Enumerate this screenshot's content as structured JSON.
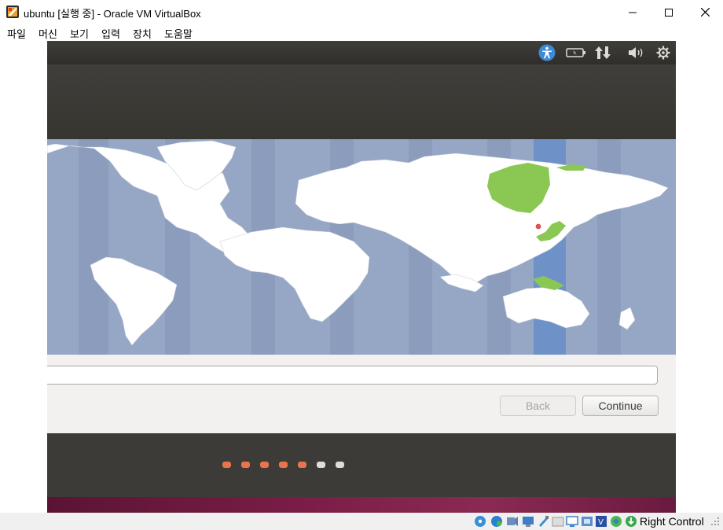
{
  "window": {
    "title": "ubuntu [실행 중] - Oracle VM VirtualBox",
    "minimize": "minimize",
    "maximize": "maximize",
    "close": "close"
  },
  "menu": [
    {
      "label": "파일"
    },
    {
      "label": "머신"
    },
    {
      "label": "보기"
    },
    {
      "label": "입력"
    },
    {
      "label": "장치"
    },
    {
      "label": "도움말"
    }
  ],
  "guest_panel": {
    "indicators": [
      "accessibility-icon",
      "battery-icon",
      "network-icon",
      "volume-icon",
      "settings-gear-icon"
    ]
  },
  "timezone": {
    "selected_marker": "Seoul",
    "input_value": "",
    "back_label": "Back",
    "continue_label": "Continue"
  },
  "progress": {
    "total_steps": 7,
    "completed_steps": 5,
    "done_color": "#e8744f",
    "todo_color": "#e0ddd8"
  },
  "statusbar": {
    "host_key_label": "Right Control",
    "icons": [
      "optical-disk-icon",
      "hard-disk-icon",
      "audio-icon",
      "network-adapter-icon",
      "usb-icon",
      "shared-folder-icon",
      "display-icon",
      "recording-icon",
      "cpu-icon",
      "virtualization-icon",
      "mouse-integration-icon",
      "keyboard-icon"
    ]
  },
  "colors": {
    "ubuntu_accent": "#e95420",
    "map_ocean": "#96a6c5",
    "map_land": "#ffffff",
    "selected_zone": "#6e92c8",
    "selected_region": "#8ac853"
  }
}
